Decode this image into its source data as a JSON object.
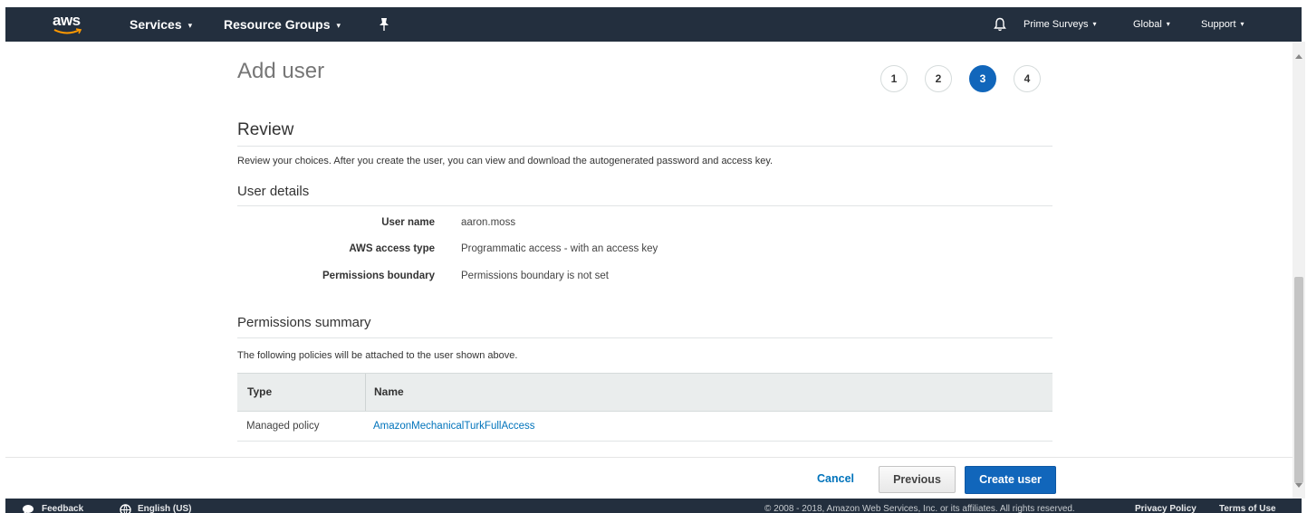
{
  "nav": {
    "logo": "aws",
    "services": "Services",
    "resource_groups": "Resource Groups",
    "account": "Prime Surveys",
    "region": "Global",
    "support": "Support",
    "caret": "▾"
  },
  "page": {
    "title": "Add user",
    "steps": [
      "1",
      "2",
      "3",
      "4"
    ],
    "active_step": "3"
  },
  "review": {
    "title": "Review",
    "description": "Review your choices. After you create the user, you can view and download the autogenerated password and access key."
  },
  "user_details": {
    "title": "User details",
    "rows": [
      {
        "label": "User name",
        "value": "aaron.moss"
      },
      {
        "label": "AWS access type",
        "value": "Programmatic access - with an access key"
      },
      {
        "label": "Permissions boundary",
        "value": "Permissions boundary is not set"
      }
    ]
  },
  "permissions": {
    "title": "Permissions summary",
    "description": "The following policies will be attached to the user shown above.",
    "columns": [
      "Type",
      "Name"
    ],
    "rows": [
      {
        "type": "Managed policy",
        "name": "AmazonMechanicalTurkFullAccess"
      }
    ]
  },
  "actions": {
    "cancel": "Cancel",
    "previous": "Previous",
    "create": "Create user"
  },
  "footer": {
    "feedback": "Feedback",
    "language": "English (US)",
    "copyright": "© 2008 - 2018, Amazon Web Services, Inc. or its affiliates. All rights reserved.",
    "privacy": "Privacy Policy",
    "terms": "Terms of Use"
  },
  "colors": {
    "nav_bg": "#232f3e",
    "primary": "#1166bb",
    "link": "#0073bb"
  }
}
